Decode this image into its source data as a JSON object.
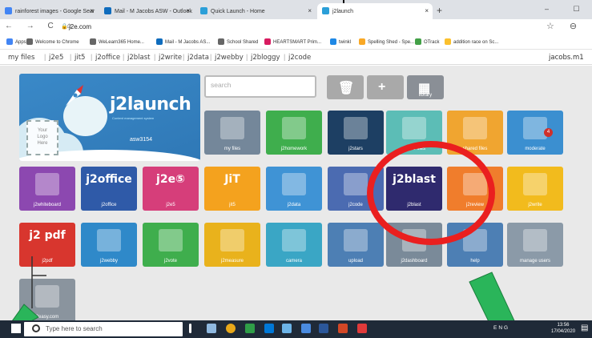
{
  "tabs": [
    {
      "label": "rainforest images - Google Sear",
      "fav": "#4285f4",
      "active": false
    },
    {
      "label": "Mail - M Jacobs ASW - Outlook",
      "fav": "#0f6cbd",
      "active": false
    },
    {
      "label": "Quick Launch - Home",
      "fav": "#2b9fd8",
      "active": false
    },
    {
      "label": "j2launch",
      "fav": "#2b9fd8",
      "active": true
    }
  ],
  "new_tab_label": "+",
  "window_controls": "– ☐",
  "url": "j2e.com",
  "bookmarks": [
    {
      "label": "Apps",
      "color": "#4285f4"
    },
    {
      "label": "Welcome to Chrome",
      "color": "#666"
    },
    {
      "label": "WeLearn365 Home...",
      "color": "#666"
    },
    {
      "label": "Mail - M Jacobs AS...",
      "color": "#0f6cbd"
    },
    {
      "label": "School Shared",
      "color": "#666"
    },
    {
      "label": "HEARTSMART Prim...",
      "color": "#d81b60"
    },
    {
      "label": "twinkl",
      "color": "#1e88e5"
    },
    {
      "label": "Spelling Shed - Spe...",
      "color": "#f9a825"
    },
    {
      "label": "OTrack",
      "color": "#43a047"
    },
    {
      "label": "addition race on Sc...",
      "color": "#fbc02d"
    }
  ],
  "j2nav": [
    "my files",
    "j2e5",
    "jit5",
    "j2office",
    "j2blast",
    "j2write",
    "j2data",
    "j2webby",
    "j2bloggy",
    "j2code"
  ],
  "user": "jacobs.m1",
  "banner": {
    "brand": "j2launch",
    "tagline": "Content management system",
    "logo_text": [
      "Your",
      "Logo",
      "Here"
    ],
    "school": "asw3154"
  },
  "search_placeholder": "search",
  "top_squares": [
    {
      "name": "delete",
      "color": "#a9a9a9"
    },
    {
      "name": "add",
      "color": "#a9a9a9"
    },
    {
      "name": "library",
      "label": "library",
      "color": "#8a8f96"
    }
  ],
  "tiles_row1": [
    {
      "label": "my files",
      "color": "#74879a"
    },
    {
      "label": "j2homework",
      "color": "#3fae4d"
    },
    {
      "label": "j2stars",
      "color": "#1d3f63"
    },
    {
      "label": "pupils files",
      "color": "#5cbdb6"
    },
    {
      "label": "shared files",
      "color": "#f0a530"
    },
    {
      "label": "moderate",
      "color": "#3b8fd0",
      "badge": "4"
    }
  ],
  "tiles_row2": [
    {
      "label": "j2whiteboard",
      "color": "#8c48b0"
    },
    {
      "label": "j2office",
      "color": "#2f5aa8",
      "big": "j2office"
    },
    {
      "label": "j2e5",
      "color": "#d63e7a",
      "big": "j2e⑤"
    },
    {
      "label": "jit5",
      "color": "#f4a21e",
      "big": "JiT"
    },
    {
      "label": "j2data",
      "color": "#3f93d5"
    },
    {
      "label": "j2code",
      "color": "#4b6bb1"
    },
    {
      "label": "j2blast",
      "color": "#2f2a6e",
      "big": "j2blast"
    },
    {
      "label": "j2review",
      "color": "#f07d2c"
    },
    {
      "label": "j2write",
      "color": "#f2bb1d"
    }
  ],
  "tiles_row3": [
    {
      "label": "j2pdf",
      "color": "#d8362e",
      "big": "j2 pdf"
    },
    {
      "label": "j2webby",
      "color": "#2f89c9"
    },
    {
      "label": "j2vote",
      "color": "#3fae4d"
    },
    {
      "label": "j2measure",
      "color": "#e9b21c"
    },
    {
      "label": "camera",
      "color": "#3aa6c5"
    },
    {
      "label": "upload",
      "color": "#4d7fb4"
    },
    {
      "label": "j2dashboard",
      "color": "#7a8a99"
    },
    {
      "label": "help",
      "color": "#4d7fb4"
    },
    {
      "label": "manage users",
      "color": "#8b9aa8"
    }
  ],
  "tile_row4": {
    "label": "2easy.com",
    "color": "#8a949e"
  },
  "taskbar": {
    "search_placeholder": "Type here to search",
    "tray": "ENG",
    "time": "13:56",
    "date": "17/04/2020"
  }
}
